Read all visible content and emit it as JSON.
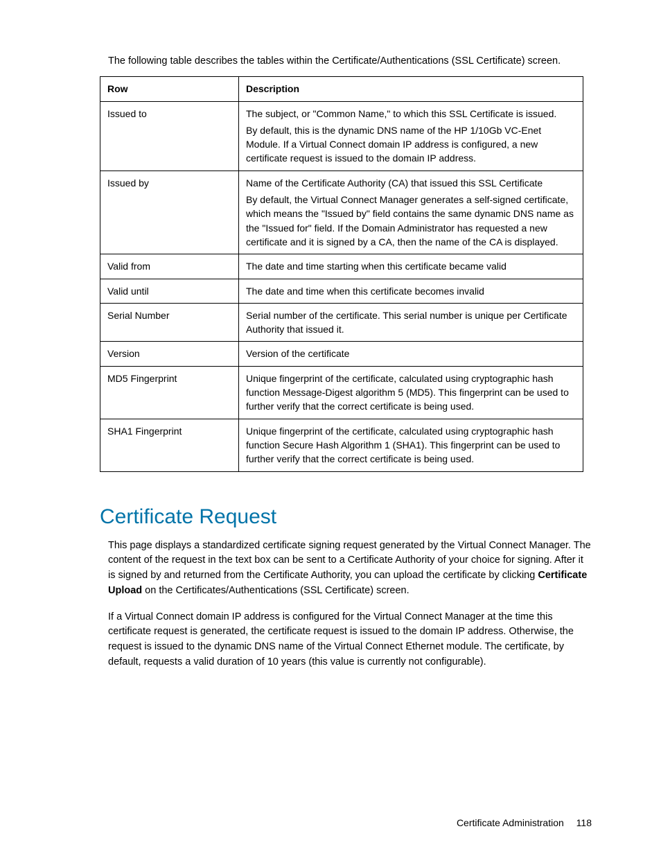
{
  "intro": "The following table describes the tables within the Certificate/Authentications (SSL Certificate) screen.",
  "table": {
    "headers": [
      "Row",
      "Description"
    ],
    "rows": [
      {
        "col1": "Issued to",
        "col2_paras": [
          "The subject, or \"Common Name,\" to which this SSL Certificate is issued.",
          "By default, this is the dynamic DNS name of the HP 1/10Gb VC-Enet Module. If a Virtual Connect domain IP address is configured, a new certificate request is issued to the domain IP address."
        ]
      },
      {
        "col1": "Issued by",
        "col2_paras": [
          "Name of the Certificate Authority (CA) that issued this SSL Certificate",
          "By default, the Virtual Connect Manager generates a self-signed certificate, which means the \"Issued by\" field contains the same dynamic DNS name as the \"Issued for\" field. If the Domain Administrator has requested a new certificate and it is signed by a CA, then the name of the CA is displayed."
        ]
      },
      {
        "col1": "Valid from",
        "col2_paras": [
          "The date and time starting when this certificate became valid"
        ]
      },
      {
        "col1": "Valid until",
        "col2_paras": [
          "The date and time when this certificate becomes invalid"
        ]
      },
      {
        "col1": "Serial Number",
        "col2_paras": [
          "Serial number of the certificate. This serial number is unique per Certificate Authority that issued it."
        ]
      },
      {
        "col1": "Version",
        "col2_paras": [
          "Version of the certificate"
        ]
      },
      {
        "col1": "MD5 Fingerprint",
        "col2_paras": [
          "Unique fingerprint of the certificate, calculated using cryptographic hash function Message-Digest algorithm 5 (MD5). This fingerprint can be used to further verify that the correct certificate is being used."
        ]
      },
      {
        "col1": "SHA1 Fingerprint",
        "col2_paras": [
          "Unique fingerprint of the certificate, calculated using cryptographic hash function Secure Hash Algorithm 1 (SHA1). This fingerprint can be used to further verify that the correct certificate is being used."
        ]
      }
    ]
  },
  "section": {
    "heading": "Certificate Request",
    "para1_pre": "This page displays a standardized certificate signing request generated by the Virtual Connect Manager. The content of the request in the text box can be sent to a Certificate Authority of your choice for signing. After it is signed by and returned from the Certificate Authority, you can upload the certificate by clicking ",
    "para1_bold": "Certificate Upload",
    "para1_post": " on the Certificates/Authentications (SSL Certificate) screen.",
    "para2": "If a Virtual Connect domain IP address is configured for the Virtual Connect Manager at the time this certificate request is generated, the certificate request is issued to the domain IP address. Otherwise, the request is issued to the dynamic DNS name of the Virtual Connect Ethernet module. The certificate, by default, requests a valid duration of 10 years (this value is currently not configurable)."
  },
  "footer": {
    "section_name": "Certificate Administration",
    "page_number": "118"
  }
}
